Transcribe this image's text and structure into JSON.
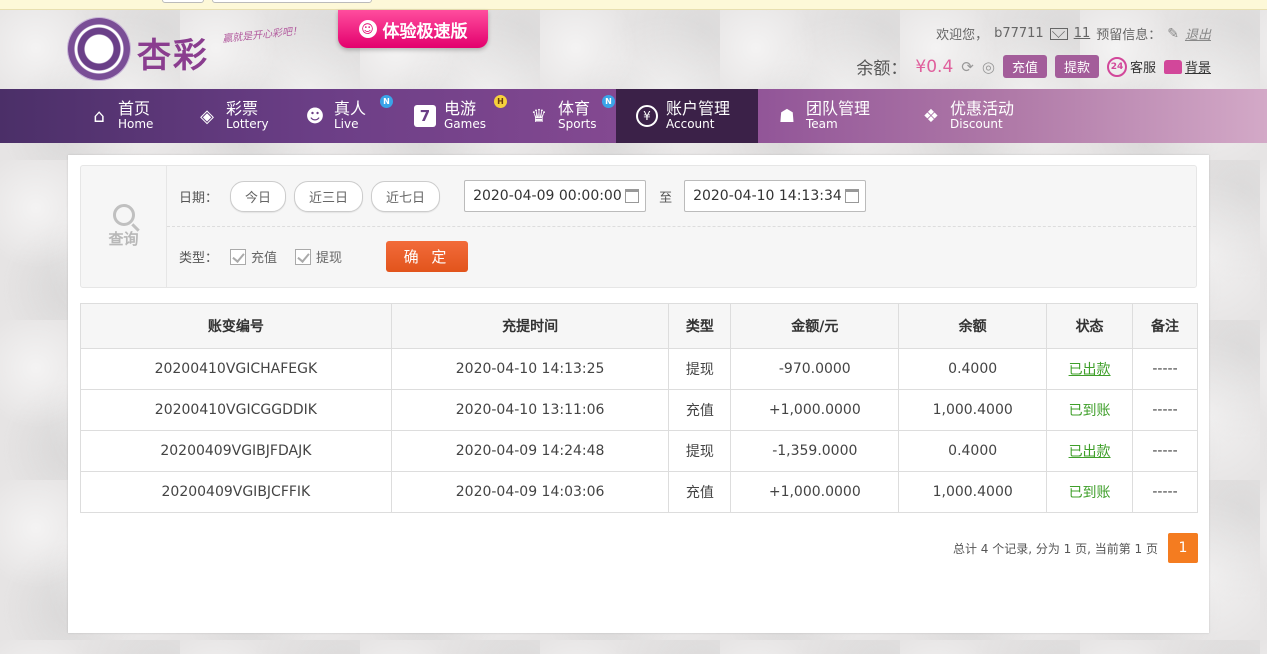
{
  "brand": {
    "logo_text": "杏彩",
    "slogan": "赢就是开心彩吧！",
    "promo_label": "体验极速版"
  },
  "user": {
    "welcome": "欢迎您，",
    "username": "b77711",
    "message_count": "11",
    "reserved_info": "预留信息：",
    "logout": "退出",
    "balance_label": "余额：",
    "balance_value": "¥0.4",
    "recharge": "充值",
    "withdraw": "提款",
    "service_badge": "24",
    "service": "客服",
    "background": "背景"
  },
  "nav": [
    {
      "zh": "首页",
      "en": "Home",
      "icon": "home-icon"
    },
    {
      "zh": "彩票",
      "en": "Lottery",
      "icon": "ticket-icon"
    },
    {
      "zh": "真人",
      "en": "Live",
      "icon": "dealer-icon",
      "badge": "N"
    },
    {
      "zh": "电游",
      "en": "Games",
      "icon": "seven-icon",
      "badge": "H"
    },
    {
      "zh": "体育",
      "en": "Sports",
      "icon": "trophy-icon",
      "badge": "N"
    },
    {
      "zh": "账户管理",
      "en": "Account",
      "icon": "yen-icon",
      "active": true
    },
    {
      "zh": "团队管理",
      "en": "Team",
      "icon": "team-icon"
    },
    {
      "zh": "优惠活动",
      "en": "Discount",
      "icon": "gift-icon"
    }
  ],
  "search": {
    "side_label": "查询",
    "date_label": "日期：",
    "quick": [
      "今日",
      "近三日",
      "近七日"
    ],
    "start": "2020-04-09 00:00:00",
    "to": "至",
    "end": "2020-04-10 14:13:34",
    "type_label": "类型：",
    "types": [
      "充值",
      "提现"
    ],
    "confirm": "确 定"
  },
  "table": {
    "headers": [
      "账变编号",
      "充提时间",
      "类型",
      "金额/元",
      "余额",
      "状态",
      "备注"
    ],
    "rows": [
      {
        "id": "20200410VGICHAFEGK",
        "time": "2020-04-10 14:13:25",
        "type": "提现",
        "amount": "-970.0000",
        "balance": "0.4000",
        "status": "已出款",
        "note": "-----"
      },
      {
        "id": "20200410VGICGGDDIK",
        "time": "2020-04-10 13:11:06",
        "type": "充值",
        "amount": "+1,000.0000",
        "balance": "1,000.4000",
        "status": "已到账",
        "note": "-----"
      },
      {
        "id": "20200409VGIBJFDAJK",
        "time": "2020-04-09 14:24:48",
        "type": "提现",
        "amount": "-1,359.0000",
        "balance": "0.4000",
        "status": "已出款",
        "note": "-----"
      },
      {
        "id": "20200409VGIBJCFFIK",
        "time": "2020-04-09 14:03:06",
        "type": "充值",
        "amount": "+1,000.0000",
        "balance": "1,000.4000",
        "status": "已到账",
        "note": "-----"
      }
    ]
  },
  "pager": {
    "summary": "总计 4 个记录, 分为 1 页, 当前第 1 页",
    "current": "1"
  },
  "colors": {
    "nav_active": "#3b2148",
    "accent_orange": "#f47c20",
    "negative_green": "#3f9f2a",
    "positive_red": "#d0281f"
  }
}
